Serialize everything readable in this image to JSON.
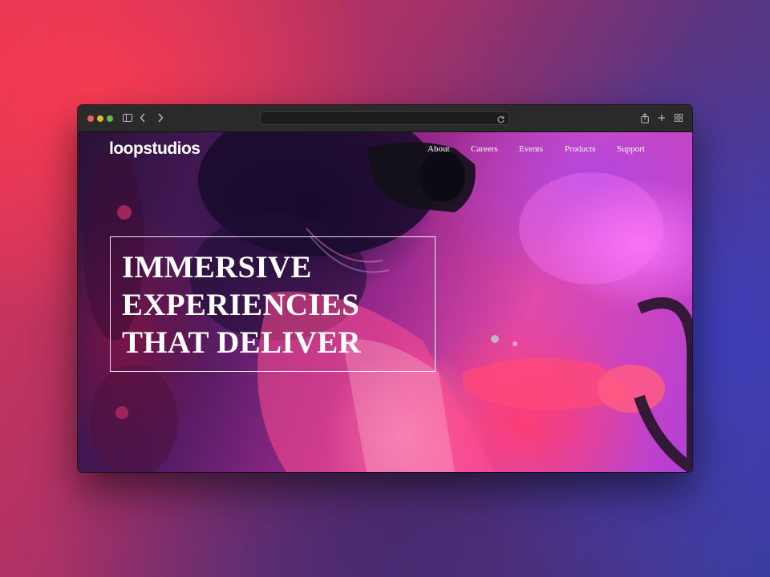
{
  "browser": {
    "address": "",
    "icons": {
      "sidebar": "sidebar-icon",
      "back": "chevron-left-icon",
      "forward": "chevron-right-icon",
      "reload": "reload-icon",
      "share": "share-icon",
      "new_tab": "plus-icon",
      "tab_overview": "grid-icon"
    }
  },
  "site": {
    "logo": "loopstudios",
    "nav": {
      "about": "About",
      "careers": "Careers",
      "events": "Events",
      "products": "Products",
      "support": "Support"
    },
    "hero": {
      "headline": "IMMERSIVE\nEXPERIENCIES\nTHAT DELIVER"
    }
  },
  "colors": {
    "traffic_red": "#ec5f57",
    "traffic_yellow": "#e4b33b",
    "traffic_green": "#5cc04a",
    "hero_text": "#ffffff"
  }
}
